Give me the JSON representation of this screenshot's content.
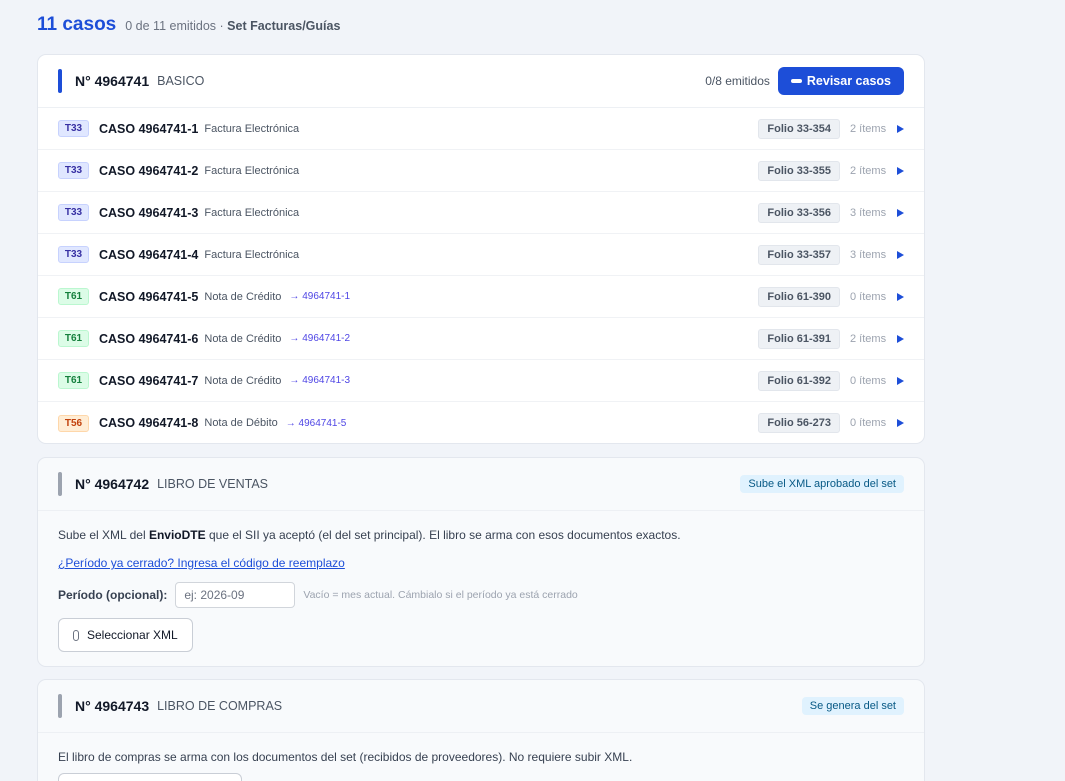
{
  "header": {
    "count": "11 casos",
    "summary": "0 de 11 emitidos ·",
    "set_name": "Set Facturas/Guías"
  },
  "sets": [
    {
      "number": "N° 4964741",
      "kind": "BASICO",
      "emitted": "0/8 emitidos",
      "action_label": "Revisar casos",
      "cases": [
        {
          "tag": "T33",
          "name": "CASO 4964741-1",
          "type": "Factura Electrónica",
          "ref": "",
          "folio": "Folio 33-354",
          "items": "2 ítems"
        },
        {
          "tag": "T33",
          "name": "CASO 4964741-2",
          "type": "Factura Electrónica",
          "ref": "",
          "folio": "Folio 33-355",
          "items": "2 ítems"
        },
        {
          "tag": "T33",
          "name": "CASO 4964741-3",
          "type": "Factura Electrónica",
          "ref": "",
          "folio": "Folio 33-356",
          "items": "3 ítems"
        },
        {
          "tag": "T33",
          "name": "CASO 4964741-4",
          "type": "Factura Electrónica",
          "ref": "",
          "folio": "Folio 33-357",
          "items": "3 ítems"
        },
        {
          "tag": "T61",
          "name": "CASO 4964741-5",
          "type": "Nota de Crédito",
          "ref": "→ 4964741-1",
          "folio": "Folio 61-390",
          "items": "0 ítems"
        },
        {
          "tag": "T61",
          "name": "CASO 4964741-6",
          "type": "Nota de Crédito",
          "ref": "→ 4964741-2",
          "folio": "Folio 61-391",
          "items": "2 ítems"
        },
        {
          "tag": "T61",
          "name": "CASO 4964741-7",
          "type": "Nota de Crédito",
          "ref": "→ 4964741-3",
          "folio": "Folio 61-392",
          "items": "0 ítems"
        },
        {
          "tag": "T56",
          "name": "CASO 4964741-8",
          "type": "Nota de Débito",
          "ref": "→ 4964741-5",
          "folio": "Folio 56-273",
          "items": "0 ítems"
        }
      ]
    },
    {
      "number": "N° 4964742",
      "kind": "LIBRO DE VENTAS",
      "status_pill": "Sube el XML aprobado del set",
      "desc_prefix": "Sube el XML del",
      "desc_bold": "EnvioDTE",
      "desc_suffix": "que el SII ya aceptó (el del set principal). El libro se arma con esos documentos exactos.",
      "link": "¿Período ya cerrado? Ingresa el código de reemplazo",
      "period_label": "Período (opcional):",
      "period_placeholder": "ej: 2026-09",
      "period_hint": "Vacío = mes actual. Cámbialo si el período ya está cerrado",
      "upload_label": "Seleccionar XML"
    },
    {
      "number": "N° 4964743",
      "kind": "LIBRO DE COMPRAS",
      "status_pill": "Se genera del set",
      "desc": "El libro de compras se arma con los documentos del set (recibidos de proveedores). No requiere subir XML."
    }
  ]
}
